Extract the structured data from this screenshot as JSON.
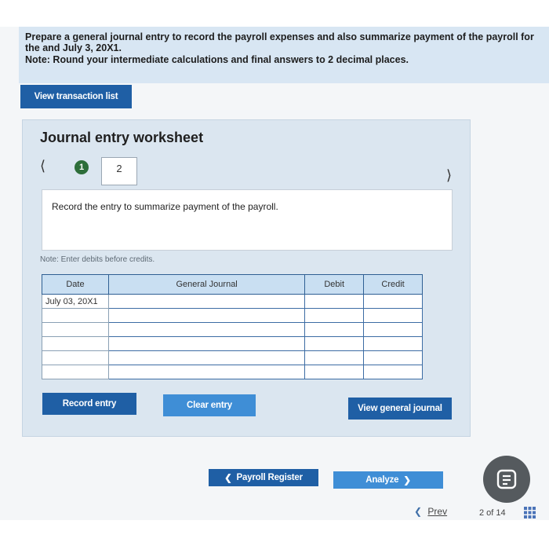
{
  "instructions": {
    "question": "Prepare a general journal entry to record the payroll expenses and also summarize payment of the payroll for the and July 3, 20X1.",
    "note": "Note: Round your intermediate calculations and final answers to 2 decimal places."
  },
  "buttons": {
    "view_transactions": "View transaction list",
    "record_entry": "Record entry",
    "clear_entry": "Clear entry",
    "view_journal": "View general journal",
    "payroll_register": "Payroll Register",
    "analyze": "Analyze"
  },
  "worksheet": {
    "title": "Journal entry worksheet",
    "steps": [
      "1",
      "2"
    ],
    "prompt": "Record the entry to summarize payment of the payroll.",
    "hint": "Note: Enter debits before credits."
  },
  "journal": {
    "headers": [
      "Date",
      "General Journal",
      "Debit",
      "Credit"
    ],
    "rows": [
      [
        "July 03, 20X1",
        "",
        "",
        ""
      ],
      [
        "",
        "",
        "",
        ""
      ],
      [
        "",
        "",
        "",
        ""
      ],
      [
        "",
        "",
        "",
        ""
      ],
      [
        "",
        "",
        "",
        ""
      ],
      [
        "",
        "",
        "",
        ""
      ]
    ]
  },
  "pagination": {
    "prev": "Prev",
    "page_of": "2 of 14"
  },
  "icons": {
    "left": "chevron-left-icon",
    "right": "chevron-right-icon",
    "chat": "chat-icon",
    "grid": "grid-icon"
  },
  "colors": {
    "accent_dark": "#1f5fa5",
    "accent_light": "#3f8ed6",
    "step_complete": "#2d6e3a"
  }
}
